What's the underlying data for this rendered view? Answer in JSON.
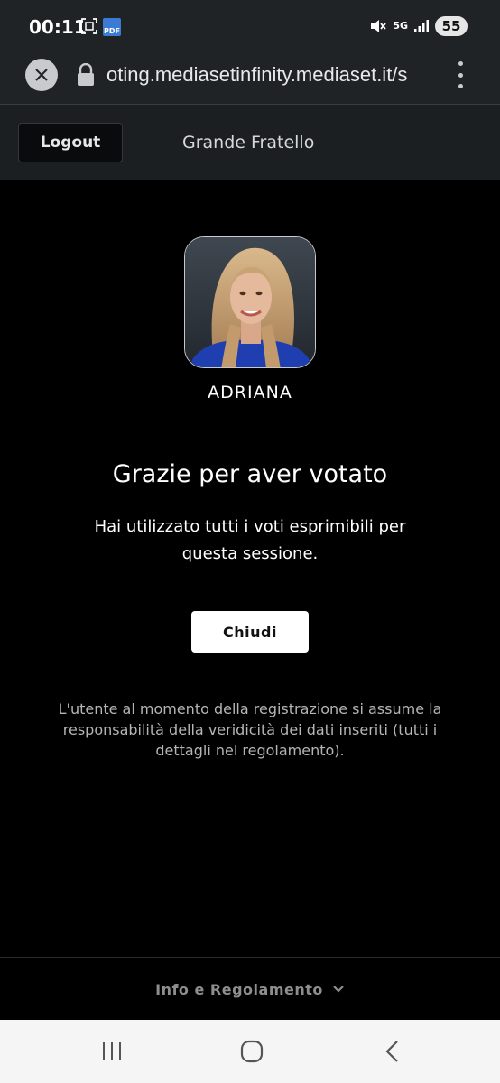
{
  "status_bar": {
    "time": "00:11",
    "pdf_label": "PDF",
    "network": "5G",
    "battery": "55"
  },
  "browser": {
    "url": "oting.mediasetinfinity.mediaset.it/s"
  },
  "header": {
    "logout_label": "Logout",
    "title": "Grande Fratello"
  },
  "contestant": {
    "name": "ADRIANA"
  },
  "confirmation": {
    "title": "Grazie per aver votato",
    "message": "Hai utilizzato tutti i voti esprimibili per questa sessione.",
    "close_label": "Chiudi"
  },
  "disclaimer": "L'utente al momento della registrazione si assume la responsabilità della veridicità dei dati inseriti (tutti i dettagli nel regolamento).",
  "footer": {
    "label": "Info e Regolamento"
  },
  "colors": {
    "background": "#000000",
    "header_bg": "#1c1f22",
    "browser_bg": "#202326",
    "button_bg": "#ffffff"
  }
}
